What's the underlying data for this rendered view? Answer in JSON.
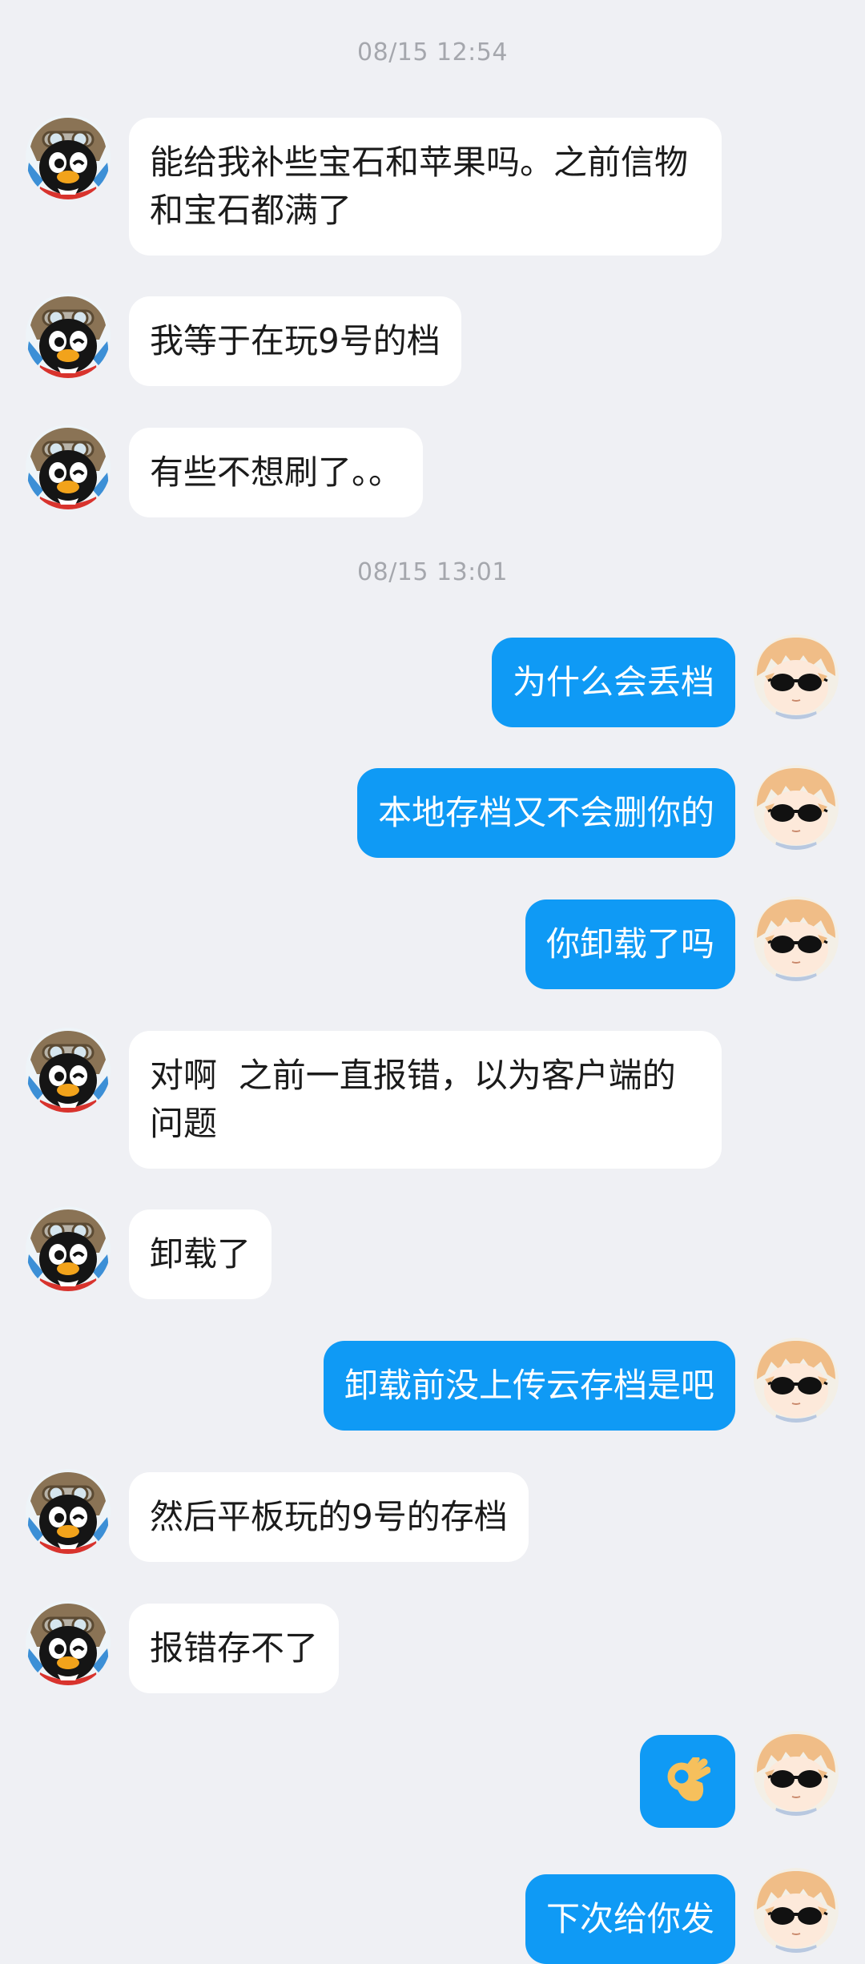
{
  "colors": {
    "background": "#eff0f4",
    "incoming_bubble": "#ffffff",
    "outgoing_bubble": "#0f9af5",
    "timestamp_text": "#a5a7ad"
  },
  "avatars": {
    "incoming": "penguin-pilot-avatar-icon",
    "outgoing": "anime-sunglasses-avatar-icon"
  },
  "messages": [
    {
      "type": "timestamp",
      "text": "08/15 12:54"
    },
    {
      "type": "in",
      "text": "能给我补些宝石和苹果吗。之前信物和宝石都满了"
    },
    {
      "type": "in",
      "text": "我等于在玩9号的档"
    },
    {
      "type": "in",
      "text": "有些不想刷了。。"
    },
    {
      "type": "timestamp",
      "text": "08/15 13:01"
    },
    {
      "type": "out",
      "text": "为什么会丢档"
    },
    {
      "type": "out",
      "text": "本地存档又不会删你的"
    },
    {
      "type": "out",
      "text": "你卸载了吗"
    },
    {
      "type": "in",
      "text": "对啊  之前一直报错，以为客户端的问题"
    },
    {
      "type": "in",
      "text": "卸载了"
    },
    {
      "type": "out",
      "text": "卸载前没上传云存档是吧"
    },
    {
      "type": "in",
      "text": "然后平板玩的9号的存档"
    },
    {
      "type": "in",
      "text": "报错存不了"
    },
    {
      "type": "out",
      "text": "",
      "emoji": "ok-hand-emoji-icon"
    },
    {
      "type": "out",
      "text": "下次给你发"
    }
  ]
}
